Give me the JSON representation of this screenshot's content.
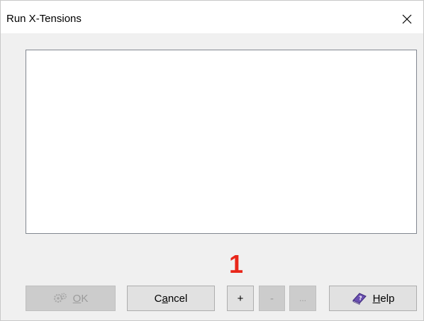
{
  "window": {
    "title": "Run X-Tensions",
    "close_glyph": "✕"
  },
  "listbox": {
    "items": []
  },
  "annotation": {
    "marker": "1",
    "color": "#e8261a"
  },
  "buttons": {
    "ok": {
      "label_underlined": "O",
      "label_rest": "K",
      "icon": "gears-icon",
      "disabled": true
    },
    "cancel": {
      "label_pre": "C",
      "label_underlined": "a",
      "label_post": "ncel"
    },
    "plus": {
      "label": "+"
    },
    "minus": {
      "label": "-",
      "disabled": true
    },
    "more": {
      "label": "...",
      "disabled": true
    },
    "help": {
      "label_underlined": "H",
      "label_rest": "elp",
      "icon": "help-book-icon"
    }
  }
}
